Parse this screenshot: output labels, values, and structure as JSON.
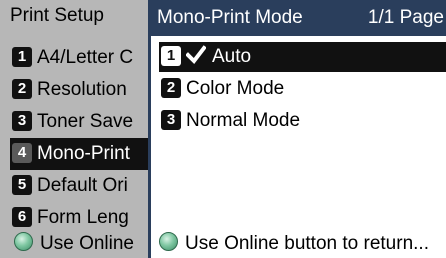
{
  "left_panel": {
    "title": "Print Setup",
    "items": [
      {
        "num": "1",
        "label": "A4/Letter C"
      },
      {
        "num": "2",
        "label": "Resolution"
      },
      {
        "num": "3",
        "label": "Toner Save"
      },
      {
        "num": "4",
        "label": "Mono-Print"
      },
      {
        "num": "5",
        "label": "Default Ori"
      },
      {
        "num": "6",
        "label": "Form Leng"
      }
    ],
    "footer": "Use Online"
  },
  "right_panel": {
    "title": "Mono-Print Mode",
    "page": "1/1 Page",
    "items": [
      {
        "num": "1",
        "label": "Auto",
        "checked": true
      },
      {
        "num": "2",
        "label": "Color Mode"
      },
      {
        "num": "3",
        "label": "Normal Mode"
      }
    ],
    "footer": "Use Online button to return..."
  },
  "colors": {
    "header_bg": "#2a3e5c",
    "left_bg": "#b7b7b7",
    "selected_bg": "#111111",
    "online_button": "#7fc7a2"
  },
  "icons": {
    "check": "checkmark-icon",
    "online": "online-button-icon"
  }
}
